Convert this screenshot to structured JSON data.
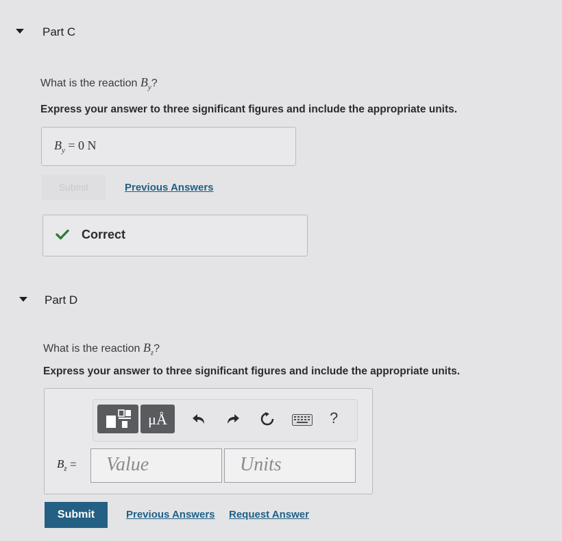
{
  "part_c": {
    "title": "Part C",
    "question_prefix": "What is the reaction ",
    "variable": "B",
    "subscript": "y",
    "question_suffix": "?",
    "instruction": "Express your answer to three significant figures and include the appropriate units.",
    "answer_label": "B",
    "answer_subscript": "y",
    "answer_value": "= 0 N",
    "submit_label": "Submit",
    "previous_answers": "Previous Answers",
    "feedback": "Correct"
  },
  "part_d": {
    "title": "Part D",
    "question_prefix": "What is the reaction ",
    "variable": "B",
    "subscript": "z",
    "question_suffix": "?",
    "instruction": "Express your answer to three significant figures and include the appropriate units.",
    "input_label": "B",
    "input_subscript": "z",
    "input_eq": "=",
    "value_placeholder": "Value",
    "units_placeholder": "Units",
    "toolbar": {
      "units_symbol": "μÅ",
      "help": "?"
    },
    "submit_label": "Submit",
    "previous_answers": "Previous Answers",
    "request_answer": "Request Answer"
  },
  "colors": {
    "accent": "#245f84",
    "link": "#1d5f86",
    "correct": "#2f7a3a"
  }
}
